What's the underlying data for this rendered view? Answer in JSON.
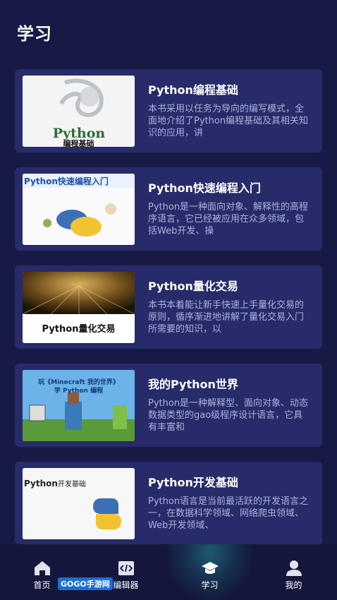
{
  "header": {
    "title": "学习"
  },
  "books": [
    {
      "title": "Python编程基础",
      "desc": "本书采用以任务为导向的编写模式，全面地介绍了Python编程基础及其相关知识的应用，讲",
      "cover_text": "Python",
      "cover_sub": "编程基础"
    },
    {
      "title": "Python快速编程入门",
      "desc": "Python是一种面向对象、解释性的高程序语言，它已经被应用在众多领域，包括Web开发、操",
      "cover_text": "Python快速编程入门"
    },
    {
      "title": "Python量化交易",
      "desc": "本书本着能让新手快速上手量化交易的原则，循序渐进地讲解了量化交易入门所需要的知识，以",
      "cover_text": "Python量化交易"
    },
    {
      "title": "我的Python世界",
      "desc": "Python是一种解释型、面向对象、动态数据类型的gao级程序设计语言，它具有丰富和",
      "cover_text": "玩《Minecraft 我的世界》",
      "cover_sub": "学 Python 编程"
    },
    {
      "title": "Python开发基础",
      "desc": "Python语言是当前最活跃的开发语言之一，在数据科学领域、网络爬虫领域、Web开发领域、",
      "cover_text": "Python",
      "cover_sub": "开发基础"
    }
  ],
  "tabbar": {
    "tabs": [
      {
        "label": "首页",
        "icon": "home-icon"
      },
      {
        "label": "编辑器",
        "icon": "code-icon"
      },
      {
        "label": "学习",
        "icon": "graduation-cap-icon",
        "active": true
      },
      {
        "label": "我的",
        "icon": "user-icon"
      }
    ]
  },
  "watermark": "GOGO手游网"
}
